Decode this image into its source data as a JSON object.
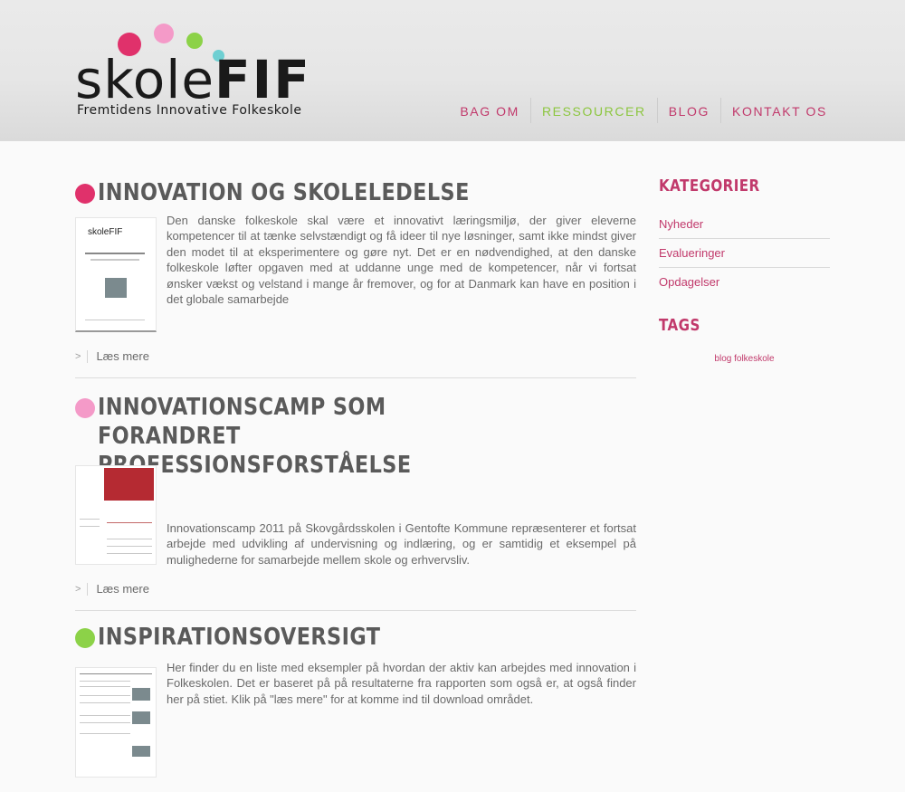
{
  "logo": {
    "word1": "skole",
    "word2": "FIF",
    "tagline": "Fremtidens Innovative Folkeskole",
    "dot_colors": [
      "#e0316b",
      "#f49ac8",
      "#8cd248",
      "#6ecfd2"
    ]
  },
  "nav": {
    "items": [
      {
        "label": "BAG OM",
        "active": false
      },
      {
        "label": "RESSOURCER",
        "active": true
      },
      {
        "label": "BLOG",
        "active": false
      },
      {
        "label": "KONTAKT OS",
        "active": false
      }
    ]
  },
  "colors": {
    "accent": "#c1396b",
    "active": "#8cc63f",
    "text": "#666666"
  },
  "posts": [
    {
      "title": "INNOVATION OG SKOLELEDELSE",
      "dot_color": "#e0316b",
      "text": "Den danske folkeskole skal være et innovativt læringsmiljø, der giver eleverne kompetencer til at tænke selvstændigt og få ideer til nye løsninger, samt ikke mindst giver den modet til at eksperimentere og gøre nyt. Det er en nødvendighed, at den danske folkeskole løfter opgaven med at uddanne unge med de kompetencer, når vi fortsat ønsker vækst og velstand i mange år fremover, og for at Danmark kan have en position i det globale samarbejde",
      "read_more": "Læs mere"
    },
    {
      "title": "INNOVATIONSCAMP SOM FORANDRET PROFESSIONSFORSTÅELSE",
      "dot_color": "#f49ac8",
      "text": "Innovationscamp 2011 på Skovgårdsskolen i Gentofte Kommune repræsenterer et fortsat arbejde med udvikling af undervisning og indlæring, og er samtidig et eksempel på mulighederne for samarbejde mellem skole og erhvervsliv.",
      "read_more": "Læs mere"
    },
    {
      "title": "INSPIRATIONSOVERSIGT",
      "dot_color": "#8cd248",
      "text": "Her finder du en liste med eksempler på hvordan der aktiv kan arbejdes med innovation i Folkeskolen. Det er baseret på på resultaterne fra rapporten som også er, at også finder her på stiet. Klik på \"læs mere\" for at komme ind til download området."
    }
  ],
  "sidebar": {
    "categories_heading": "KATEGORIER",
    "categories": [
      "Nyheder",
      "Evalueringer",
      "Opdagelser"
    ],
    "tags_heading": "TAGS",
    "tags": "blog folkeskole"
  }
}
